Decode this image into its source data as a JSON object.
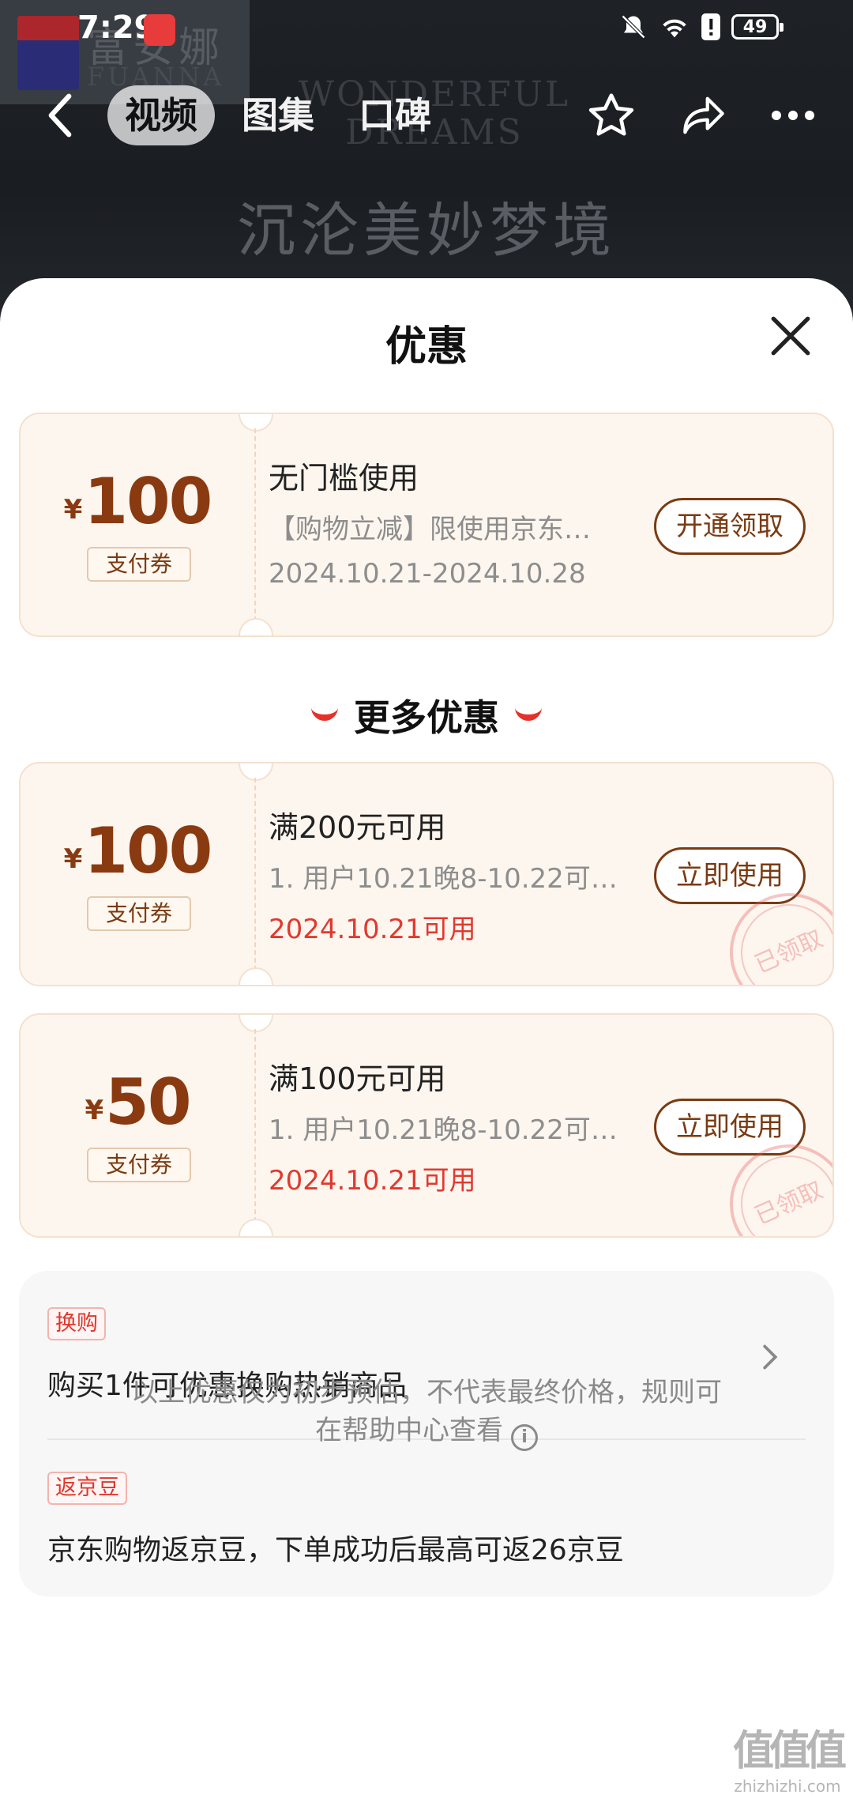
{
  "status_bar": {
    "time": "7:29",
    "battery": "49"
  },
  "hero": {
    "logo_cn": "富安娜",
    "logo_en": "FUANNA",
    "title_en_line1": "WONDERFUL",
    "title_en_line2": "DREAMS",
    "title_cn": "沉沦美妙梦境"
  },
  "nav": {
    "tabs": [
      {
        "label": "视频",
        "active": true
      },
      {
        "label": "图集",
        "active": false
      },
      {
        "label": "口碑",
        "active": false
      }
    ]
  },
  "sheet": {
    "title": "优惠",
    "coupons": [
      {
        "currency": "¥",
        "amount": "100",
        "type": "支付券",
        "title": "无门槛使用",
        "desc": "【购物立减】限使用京东…",
        "date": "2024.10.21-2024.10.28",
        "button": "开通领取",
        "claimed": false
      }
    ],
    "more_heading": "更多优惠",
    "more_coupons": [
      {
        "currency": "¥",
        "amount": "100",
        "type": "支付券",
        "title": "满200元可用",
        "desc": "1. 用户10.21晚8-10.22可…",
        "date": "2024.10.21可用",
        "button": "立即使用",
        "stamp": "已领取"
      },
      {
        "currency": "¥",
        "amount": "50",
        "type": "支付券",
        "title": "满100元可用",
        "desc": "1. 用户10.21晚8-10.22可…",
        "date": "2024.10.21可用",
        "button": "立即使用",
        "stamp": "已领取"
      }
    ],
    "extras": [
      {
        "tag": "换购",
        "text": "购买1件可优惠换购热销商品"
      },
      {
        "tag": "返京豆",
        "text": "京东购物返京豆，下单成功后最高可返26京豆"
      }
    ],
    "footnote_line1": "以上优惠仅为初步预估，不代表最终价格，规则可",
    "footnote_line2": "在帮助中心查看"
  },
  "watermark": {
    "mark": "值值值",
    "site": "zhizhizhi.com"
  }
}
